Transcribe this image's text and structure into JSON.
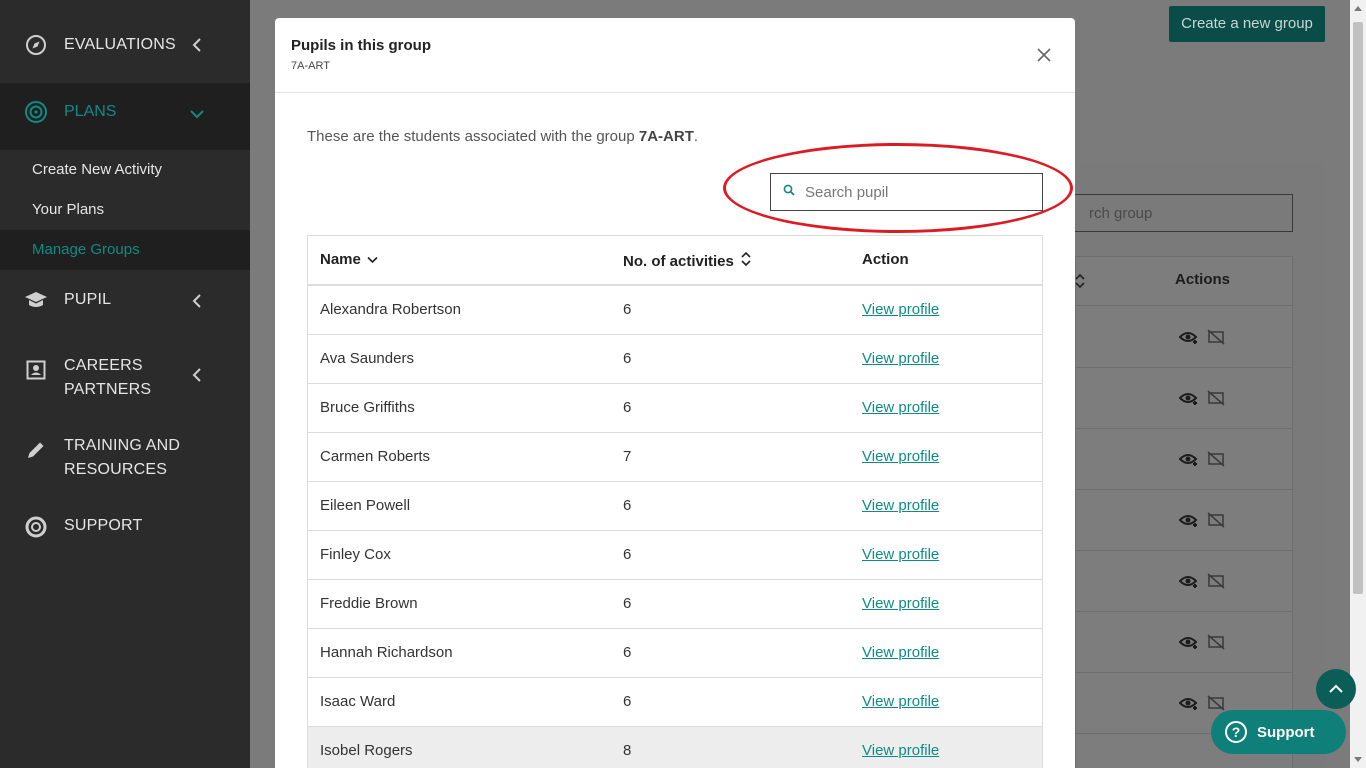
{
  "sidebar": {
    "items": [
      {
        "label": "EVALUATIONS",
        "icon": "compass-icon"
      },
      {
        "label": "PLANS",
        "icon": "target-icon"
      },
      {
        "label": "PUPIL",
        "icon": "graduation-cap-icon"
      },
      {
        "label_line1": "CAREERS",
        "label_line2": "PARTNERS",
        "icon": "contact-card-icon"
      },
      {
        "label_line1": "TRAINING AND",
        "label_line2": "RESOURCES",
        "icon": "pencil-icon"
      },
      {
        "label": "SUPPORT",
        "icon": "lifebuoy-icon"
      }
    ],
    "plans_sub": [
      "Create New Activity",
      "Your Plans",
      "Manage Groups"
    ]
  },
  "background": {
    "create_button": "Create a new group",
    "search_placeholder_fragment": "rch group",
    "actions_header": "Actions"
  },
  "modal": {
    "title": "Pupils in this group",
    "subtitle": "7A-ART",
    "intro_text": "These are the students associated with the group ",
    "intro_group": "7A-ART",
    "intro_end": ".",
    "search_placeholder": "Search pupil",
    "columns": [
      "Name",
      "No. of activities",
      "Action"
    ],
    "rows": [
      {
        "name": "Alexandra Robertson",
        "count": "6",
        "action": "View profile"
      },
      {
        "name": "Ava Saunders",
        "count": "6",
        "action": "View profile"
      },
      {
        "name": "Bruce Griffiths",
        "count": "6",
        "action": "View profile"
      },
      {
        "name": "Carmen Roberts",
        "count": "7",
        "action": "View profile"
      },
      {
        "name": "Eileen Powell",
        "count": "6",
        "action": "View profile"
      },
      {
        "name": "Finley Cox",
        "count": "6",
        "action": "View profile"
      },
      {
        "name": "Freddie Brown",
        "count": "6",
        "action": "View profile"
      },
      {
        "name": "Hannah Richardson",
        "count": "6",
        "action": "View profile"
      },
      {
        "name": "Isaac Ward",
        "count": "6",
        "action": "View profile"
      },
      {
        "name": "Isobel Rogers",
        "count": "8",
        "action": "View profile"
      }
    ]
  },
  "support_button": "Support",
  "colors": {
    "accent": "#0e8c84",
    "annotation": "#dc1c24",
    "sidebar": "#2b2b2b"
  }
}
